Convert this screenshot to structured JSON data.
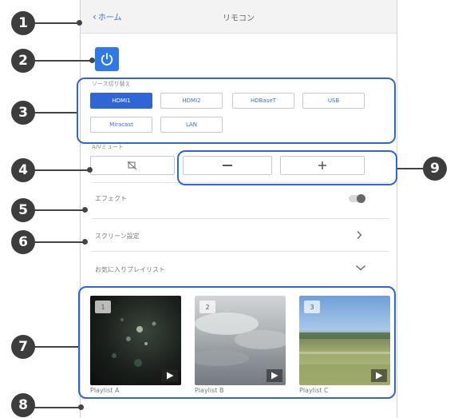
{
  "header": {
    "back_label": "ホーム",
    "title": "リモコン"
  },
  "sources": {
    "label": "ソース切り替え",
    "buttons": [
      "HDMI1",
      "HDMI2",
      "HDBaseT",
      "USB",
      "Miracast",
      "LAN"
    ],
    "selected": "HDMI1"
  },
  "av_mute": {
    "label": "A/Vミュート"
  },
  "effect": {
    "label": "エフェクト",
    "enabled": false
  },
  "screen_settings": {
    "label": "スクリーン設定"
  },
  "favorites": {
    "label": "お気に入りプレイリスト",
    "items": [
      {
        "number": "1",
        "name": "Playlist A"
      },
      {
        "number": "2",
        "name": "Playlist B"
      },
      {
        "number": "3",
        "name": "Playlist C"
      }
    ]
  },
  "callouts": [
    "1",
    "2",
    "3",
    "4",
    "5",
    "6",
    "7",
    "8",
    "9"
  ],
  "colors": {
    "accent": "#2f66d6",
    "power": "#2f78e8",
    "callout": "#3d3d3d"
  }
}
